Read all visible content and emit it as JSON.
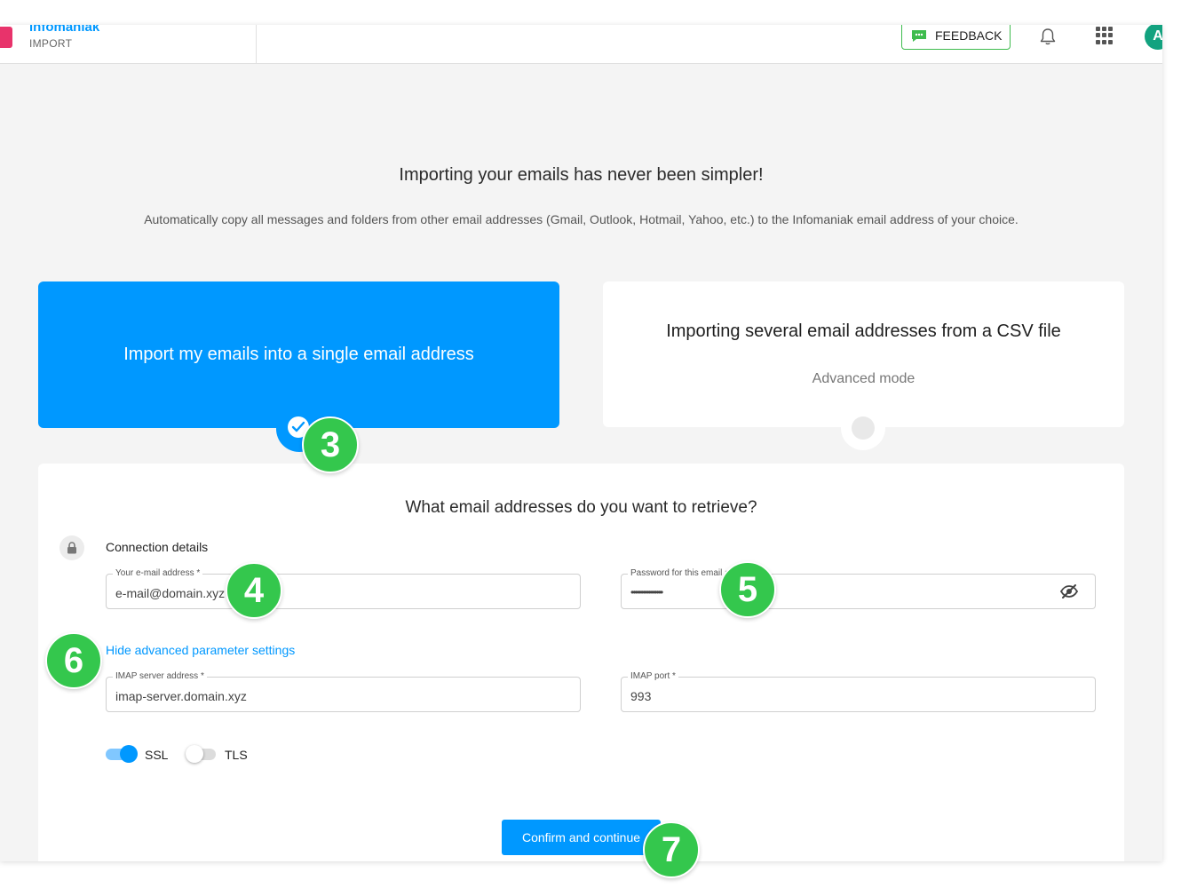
{
  "topbar": {
    "brand_name": "infomaniak",
    "brand_sub": "IMPORT",
    "feedback_label": "FEEDBACK",
    "avatar_initial": "A"
  },
  "intro": {
    "headline": "Importing your emails has never been simpler!",
    "subtitle": "Automatically copy all messages and folders from other email addresses (Gmail, Outlook, Hotmail, Yahoo, etc.) to the Infomaniak email address of your choice."
  },
  "options": {
    "single": {
      "title": "Import my emails into a single email address",
      "selected": true
    },
    "csv": {
      "title": "Importing several email addresses from a CSV file",
      "subtitle": "Advanced mode",
      "selected": false
    }
  },
  "form": {
    "title": "What email addresses do you want to retrieve?",
    "connection_label": "Connection details",
    "email": {
      "label": "Your e-mail address *",
      "value": "e-mail@domain.xyz"
    },
    "password": {
      "label": "Password for this email address *",
      "value": "••••••••••••••••"
    },
    "advanced_link": "Hide advanced parameter settings",
    "imap_server": {
      "label": "IMAP server address *",
      "value": "imap-server.domain.xyz"
    },
    "imap_port": {
      "label": "IMAP port *",
      "value": "993"
    },
    "ssl": {
      "label": "SSL",
      "on": true
    },
    "tls": {
      "label": "TLS",
      "on": false
    },
    "confirm_label": "Confirm and continue"
  },
  "badges": [
    "3",
    "4",
    "5",
    "6",
    "7"
  ],
  "colors": {
    "accent": "#0098ff",
    "badge": "#34c74d",
    "feedback_border": "#3ebc4e",
    "avatar": "#12a27f",
    "logo": "#e8336b"
  }
}
